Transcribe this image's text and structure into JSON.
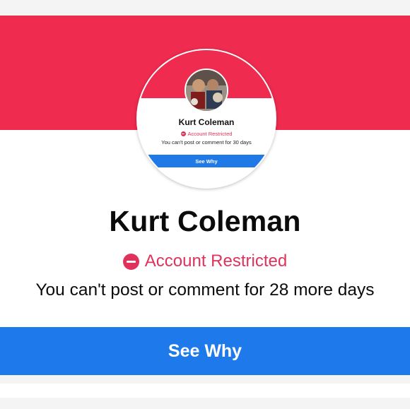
{
  "profile": {
    "name": "Kurt Coleman",
    "status": "Account Restricted",
    "message": "You can't post or comment for 28 more days",
    "button_label": "See Why"
  },
  "preview": {
    "name": "Kurt Coleman",
    "status": "Account Restricted",
    "message": "You can't post or comment for 30 days",
    "button_label": "See Why"
  },
  "colors": {
    "banner": "#ef2b4f",
    "restricted": "#e0325a",
    "button": "#1e7aea"
  },
  "icons": {
    "status": "restricted-icon"
  }
}
